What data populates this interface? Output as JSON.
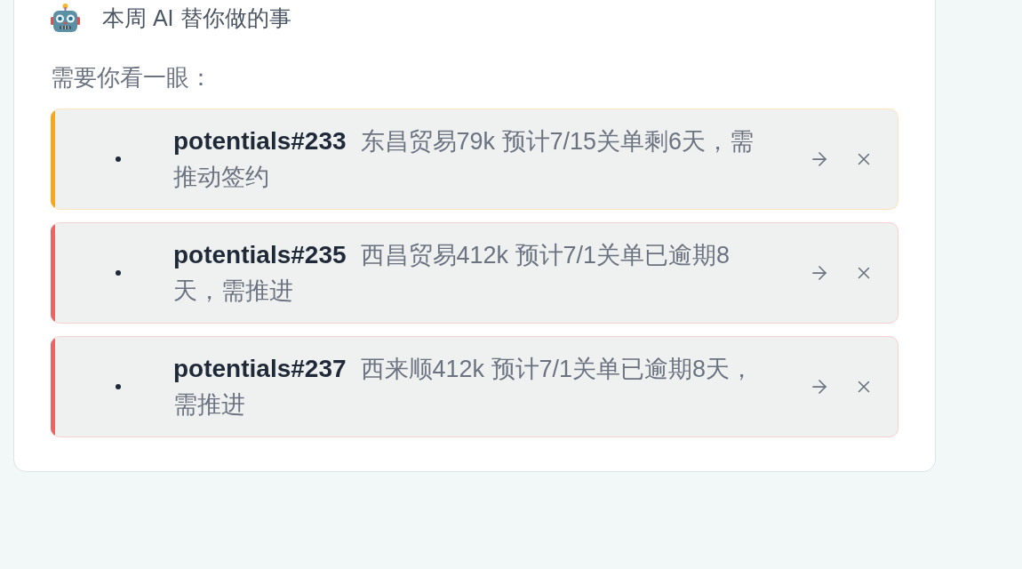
{
  "header": {
    "title": "本周 AI 替你做的事"
  },
  "attention": {
    "heading": "需要你看一眼：",
    "items": [
      {
        "ref": "potentials#233",
        "summary": "东昌贸易79k 预计7/15关单剩6天，需推动签约",
        "color": "#f5a623"
      },
      {
        "ref": "potentials#235",
        "summary": "西昌贸易412k 预计7/1关单已逾期8天，需推进",
        "color": "#e96565"
      },
      {
        "ref": "potentials#237",
        "summary": "西来顺412k 预计7/1关单已逾期8天，需推进",
        "color": "#e96565"
      }
    ]
  }
}
